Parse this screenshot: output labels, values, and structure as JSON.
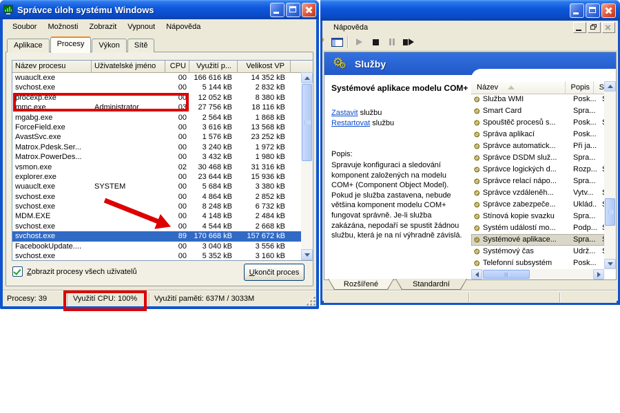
{
  "colors": {
    "annotation": "#DD0000",
    "selection": "#316AC5",
    "banner_blue": "#2258C8",
    "titlebar_blue": "#0E58DC"
  },
  "taskman": {
    "title": "Správce úloh systému Windows",
    "menu": [
      "Soubor",
      "Možnosti",
      "Zobrazit",
      "Vypnout",
      "Nápověda"
    ],
    "tabs": [
      "Aplikace",
      "Procesy",
      "Výkon",
      "Sítě"
    ],
    "active_tab": "Procesy",
    "columns": [
      "Název procesu",
      "Uživatelské jméno",
      "CPU",
      "Využití p...",
      "Velikost VP"
    ],
    "rows": [
      {
        "name": "wuauclt.exe",
        "user": "",
        "cpu": "00",
        "mem": "166 616 kB",
        "vm": "14 352 kB"
      },
      {
        "name": "svchost.exe",
        "user": "",
        "cpu": "00",
        "mem": "5 144 kB",
        "vm": "2 832 kB"
      },
      {
        "name": "procexp.exe",
        "user": "",
        "cpu": "00",
        "mem": "12 052 kB",
        "vm": "8 380 kB",
        "red_boxed": true
      },
      {
        "name": "mmc.exe",
        "user": "Administrator",
        "cpu": "03",
        "mem": "27 756 kB",
        "vm": "18 116 kB"
      },
      {
        "name": "mgabg.exe",
        "user": "",
        "cpu": "00",
        "mem": "2 564 kB",
        "vm": "1 868 kB"
      },
      {
        "name": "ForceField.exe",
        "user": "",
        "cpu": "00",
        "mem": "3 616 kB",
        "vm": "13 568 kB"
      },
      {
        "name": "AvastSvc.exe",
        "user": "",
        "cpu": "00",
        "mem": "1 576 kB",
        "vm": "23 252 kB"
      },
      {
        "name": "Matrox.Pdesk.Ser...",
        "user": "",
        "cpu": "00",
        "mem": "3 240 kB",
        "vm": "1 972 kB"
      },
      {
        "name": "Matrox.PowerDes...",
        "user": "",
        "cpu": "00",
        "mem": "3 432 kB",
        "vm": "1 980 kB"
      },
      {
        "name": "vsmon.exe",
        "user": "",
        "cpu": "02",
        "mem": "30 468 kB",
        "vm": "31 316 kB"
      },
      {
        "name": "explorer.exe",
        "user": "",
        "cpu": "00",
        "mem": "23 644 kB",
        "vm": "15 936 kB"
      },
      {
        "name": "wuauclt.exe",
        "user": "SYSTEM",
        "cpu": "00",
        "mem": "5 684 kB",
        "vm": "3 380 kB"
      },
      {
        "name": "svchost.exe",
        "user": "",
        "cpu": "00",
        "mem": "4 864 kB",
        "vm": "2 852 kB"
      },
      {
        "name": "svchost.exe",
        "user": "",
        "cpu": "00",
        "mem": "8 248 kB",
        "vm": "6 732 kB"
      },
      {
        "name": "MDM.EXE",
        "user": "",
        "cpu": "00",
        "mem": "4 148 kB",
        "vm": "2 484 kB"
      },
      {
        "name": "svchost.exe",
        "user": "",
        "cpu": "00",
        "mem": "4 544 kB",
        "vm": "2 668 kB"
      },
      {
        "name": "svchost.exe",
        "user": "",
        "cpu": "89",
        "mem": "170 668 kB",
        "vm": "157 672 kB",
        "selected": true
      },
      {
        "name": "FacebookUpdate....",
        "user": "",
        "cpu": "00",
        "mem": "3 040 kB",
        "vm": "3 556 kB"
      },
      {
        "name": "svchost.exe",
        "user": "",
        "cpu": "00",
        "mem": "5 352 kB",
        "vm": "3 160 kB"
      }
    ],
    "show_all_accel": "Z",
    "show_all_rest": "obrazit procesy všech uživatelů",
    "show_all_checked": true,
    "end_process_accel": "U",
    "end_process_rest": "končit proces",
    "status": {
      "processes": "Procesy: 39",
      "cpu": "Využití CPU: 100%",
      "memory": "Využití paměti: 637M / 3033M"
    }
  },
  "services": {
    "menu": "Nápověda",
    "banner_title": "Služby",
    "detail": {
      "title": "Systémové aplikace modelu COM+",
      "stop_link": "Zastavit",
      "stop_rest": " službu",
      "restart_link": "Restartovat",
      "restart_rest": " službu",
      "popis_label": "Popis:",
      "description": "Spravuje konfiguraci a sledování komponent založených na modelu COM+ (Component Object Model). Pokud je služba zastavena, nebude většina komponent modelu COM+ fungovat správně. Je-li služba zakázána, nepodaří se spustit žádnou službu, která je na ní výhradně závislá."
    },
    "columns": [
      "Název",
      "Popis",
      "S"
    ],
    "rows": [
      {
        "name": "Služba WMI",
        "desc": "Posk...",
        "state": "Sp"
      },
      {
        "name": "Smart Card",
        "desc": "Spra...",
        "state": ""
      },
      {
        "name": "Spouštěč procesů s...",
        "desc": "Posk...",
        "state": "Sp"
      },
      {
        "name": "Správa aplikací",
        "desc": "Posk...",
        "state": ""
      },
      {
        "name": "Správce automatick...",
        "desc": "Při ja...",
        "state": ""
      },
      {
        "name": "Správce DSDM služ...",
        "desc": "Spra...",
        "state": ""
      },
      {
        "name": "Správce logických d...",
        "desc": "Rozp...",
        "state": "Sp"
      },
      {
        "name": "Správce relací nápo...",
        "desc": "Spra...",
        "state": ""
      },
      {
        "name": "Správce vzdáleněh...",
        "desc": "Vytv...",
        "state": "Sp"
      },
      {
        "name": "Správce zabezpeče...",
        "desc": "Uklád...",
        "state": "Sp"
      },
      {
        "name": "Stínová kopie svazku",
        "desc": "Spra...",
        "state": ""
      },
      {
        "name": "Systém událostí mo...",
        "desc": "Podp...",
        "state": "Sp"
      },
      {
        "name": "Systémové aplikace...",
        "desc": "Spra...",
        "state": "Sp",
        "selected": true
      },
      {
        "name": "Systémový čas",
        "desc": "Udrž...",
        "state": "Sp"
      },
      {
        "name": "Telefonní subsystém",
        "desc": "Posk...",
        "state": ""
      }
    ],
    "bottom_tabs": [
      "Rozšířené",
      "Standardní"
    ],
    "active_bottom_tab": "Rozšířené"
  }
}
